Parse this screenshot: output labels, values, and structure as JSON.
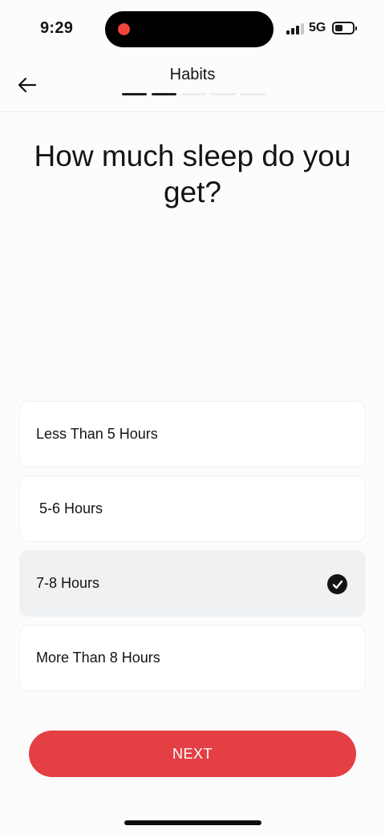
{
  "status_bar": {
    "time": "9:29",
    "network": "5G",
    "signal_bars_active": 3,
    "signal_bars_total": 4
  },
  "header": {
    "title": "Habits",
    "progress": {
      "completed_steps": 2,
      "total_steps": 5
    }
  },
  "question": "How much sleep do you get?",
  "options": [
    {
      "label": "Less Than 5 Hours",
      "selected": false
    },
    {
      "label": "5-6 Hours",
      "selected": false
    },
    {
      "label": "7-8 Hours",
      "selected": true
    },
    {
      "label": "More Than 8 Hours",
      "selected": false
    }
  ],
  "next_button": {
    "label": "NEXT"
  },
  "colors": {
    "accent": "#e43f45",
    "selected_option_bg": "#eff1f3",
    "recording_indicator": "#f0443c"
  },
  "icons": {
    "back": "arrow-left-icon",
    "check": "check-circle-icon",
    "signal": "signal-icon",
    "battery": "battery-icon"
  }
}
